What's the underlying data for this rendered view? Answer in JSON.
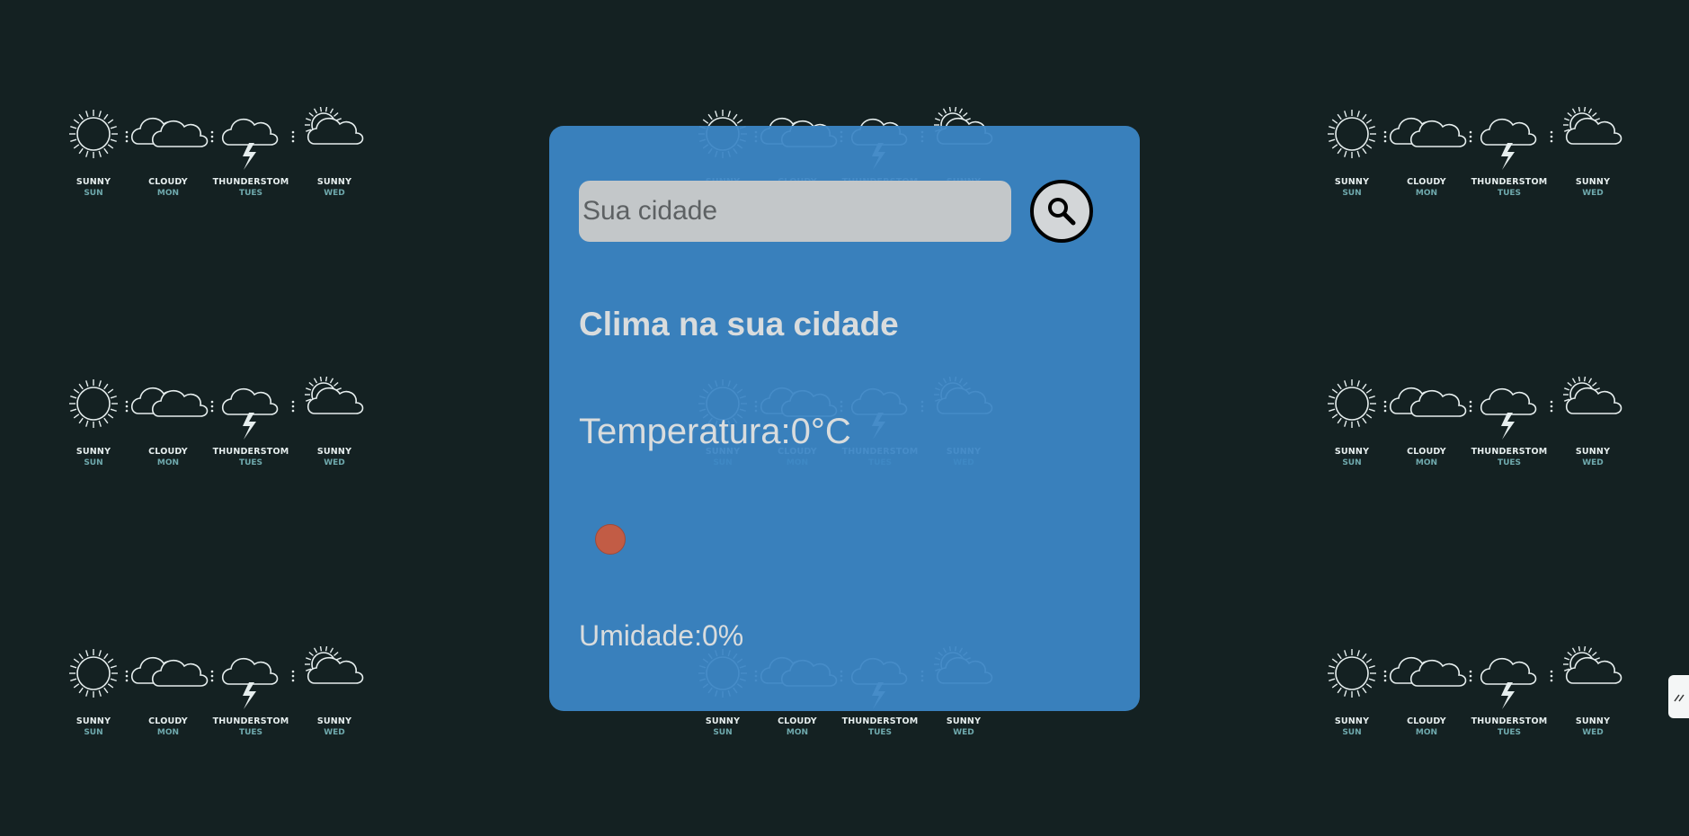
{
  "app": {
    "search": {
      "placeholder": "Sua cidade"
    },
    "title": "Clima na sua cidade",
    "temperature": {
      "label": "Temperatura: ",
      "value": "0",
      "unit": "°C"
    },
    "humidity": {
      "label": "Umidade: ",
      "value": "0",
      "unit": "%"
    }
  },
  "background": {
    "forecast": [
      {
        "weather": "SUNNY",
        "day": "SUN",
        "icon": "sun-icon"
      },
      {
        "weather": "CLOUDY",
        "day": "MON",
        "icon": "cloud-icon"
      },
      {
        "weather": "THUNDERSTOM",
        "day": "TUES",
        "icon": "thunderstorm-icon"
      },
      {
        "weather": "SUNNY",
        "day": "WED",
        "icon": "sun-cloud-icon"
      }
    ]
  },
  "colors": {
    "background": "#142122",
    "card": "#3b86c6",
    "weather_dot": "#c25c45",
    "day_label": "#6fa9ad"
  }
}
